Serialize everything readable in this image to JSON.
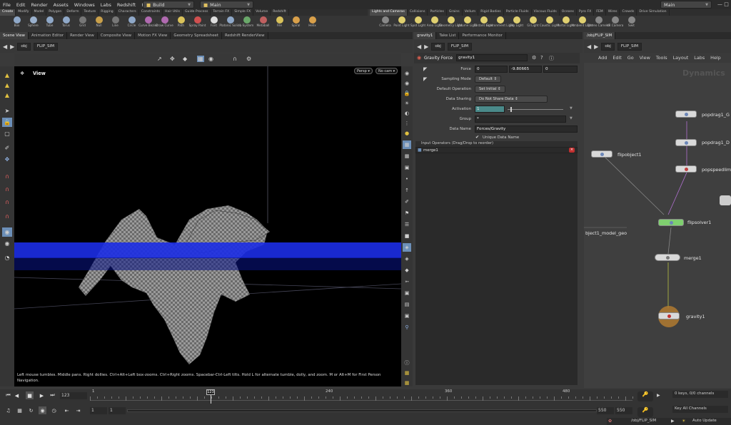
{
  "menu": [
    "File",
    "Edit",
    "Render",
    "Assets",
    "Windows",
    "Labs",
    "Redshift",
    "Help"
  ],
  "desktop": {
    "build": "Build",
    "main": "Main",
    "right_main": "Main"
  },
  "shelf_tabs_left": [
    "Create",
    "Modify",
    "Model",
    "Polygon",
    "Deform",
    "Texture",
    "Rigging",
    "Characters",
    "Constraints",
    "Hair Utils",
    "Guide Process",
    "Terrain FX",
    "Simple FX",
    "Volume",
    "Redshift"
  ],
  "shelf_tabs_right": [
    "Lights and Cameras",
    "Collisions",
    "Particles",
    "Grains",
    "Vellum",
    "Rigid Bodies",
    "Particle Fluids",
    "Viscous Fluids",
    "Oceans",
    "Pyro FX",
    "FEM",
    "Wires",
    "Crowds",
    "Drive Simulation"
  ],
  "tools_left": [
    {
      "label": "Box",
      "color": "#8fa8c8"
    },
    {
      "label": "Sphere",
      "color": "#9ab0cc"
    },
    {
      "label": "Tube",
      "color": "#8fa8c8"
    },
    {
      "label": "Torus",
      "color": "#8fa8c8"
    },
    {
      "label": "Grid",
      "color": "#777"
    },
    {
      "label": "Null",
      "color": "#c9a04a"
    },
    {
      "label": "Line",
      "color": "#777"
    },
    {
      "label": "Circle",
      "color": "#8fa8c8"
    },
    {
      "label": "Curve Bezier",
      "color": "#b06ab0"
    },
    {
      "label": "Draw Curve",
      "color": "#b06ab0"
    },
    {
      "label": "Path",
      "color": "#d9c25a"
    },
    {
      "label": "Spray Paint",
      "color": "#d05050"
    },
    {
      "label": "Font",
      "color": "#dddddd"
    },
    {
      "label": "Platonic Solids",
      "color": "#8fa8c8"
    },
    {
      "label": "L-System",
      "color": "#6aa86a"
    },
    {
      "label": "Metaball",
      "color": "#c06060"
    },
    {
      "label": "File",
      "color": "#d9c25a"
    },
    {
      "label": "Spiral",
      "color": "#d9a04a"
    },
    {
      "label": "Helix",
      "color": "#d9a04a"
    }
  ],
  "tools_right": [
    {
      "label": "Camera",
      "color": "#888"
    },
    {
      "label": "Point Light",
      "color": "#e0d070"
    },
    {
      "label": "Spot Light",
      "color": "#e0d070"
    },
    {
      "label": "Area Light",
      "color": "#e0d070"
    },
    {
      "label": "Geometry Light",
      "color": "#e0d070"
    },
    {
      "label": "Volume Light",
      "color": "#e0d070"
    },
    {
      "label": "Distant Light",
      "color": "#e0d070"
    },
    {
      "label": "Environment Light",
      "color": "#e0d070"
    },
    {
      "label": "Sky Light",
      "color": "#e0d070"
    },
    {
      "label": "GI Light",
      "color": "#e0d070"
    },
    {
      "label": "Caustic Light",
      "color": "#e0d070"
    },
    {
      "label": "Portal Light",
      "color": "#e0d070"
    },
    {
      "label": "Ambient Light",
      "color": "#e0d070"
    },
    {
      "label": "Stereo Camera",
      "color": "#888"
    },
    {
      "label": "VR Camera",
      "color": "#888"
    },
    {
      "label": "Swit",
      "color": "#888"
    }
  ],
  "pane_tabs_left": [
    "Scene View",
    "Animation Editor",
    "Render View",
    "Composite View",
    "Motion FX View",
    "Geometry Spreadsheet",
    "Redshift RenderView"
  ],
  "pane_tabs_mid": [
    "gravity1",
    "Take List",
    "Performance Monitor"
  ],
  "pane_tabs_right": [
    "/obj/FLIP_SIM"
  ],
  "path": {
    "context": "obj",
    "network": "FLIP_SIM"
  },
  "viewport": {
    "title": "View",
    "persp": "Persp ▾",
    "cam": "No cam ▾",
    "help": "Left mouse tumbles. Middle pans. Right dollies. Ctrl+Alt+Left box-zooms. Ctrl+Right zooms. Spacebar-Ctrl-Left tilts. Hold L for alternate tumble, dolly, and zoom. M or Alt+M for First Person Navigation."
  },
  "params": {
    "node_type": "Gravity Force",
    "node_name": "gravity1",
    "force_label": "Force",
    "force": [
      "0",
      "-9.80665",
      "0"
    ],
    "sampling_label": "Sampling Mode",
    "sampling": "Default",
    "default_op_label": "Default Operation",
    "default_op": "Set Initial",
    "data_sharing_label": "Data Sharing",
    "data_sharing": "Do Not Share Data",
    "activation_label": "Activation",
    "activation": "1",
    "group_label": "Group",
    "group": "*",
    "data_name_label": "Data Name",
    "data_name": "Forces/Gravity",
    "unique_label": "Unique Data Name",
    "input_ops_header": "Input Operators (Drag/Drop to reorder)",
    "input_op": "merge1"
  },
  "network": {
    "menu": [
      "Add",
      "Edit",
      "Go",
      "View",
      "Tools",
      "Layout",
      "Labs",
      "Help"
    ],
    "context_label": "Dynamics",
    "nodes": {
      "popdrag1": "popdrag1_G",
      "popdrag2": "popdrag1_D",
      "popspeed": "popspeedlim",
      "flipobject": "flipobject1",
      "flipsolver": "flipsolver1",
      "merge": "merge1",
      "gravity": "gravity1",
      "objmerge": "bject1_model_geo"
    }
  },
  "timeline": {
    "frame": "123",
    "ticks": [
      "1",
      "240",
      "360",
      "480"
    ],
    "marker": "123",
    "start": "1",
    "start2": "1",
    "end": "550",
    "end2": "550",
    "keys": "0 keys, 0/0 channels",
    "key_all": "Key All Channels",
    "status_path": "/obj/FLIP_SIM",
    "auto_update": "Auto Update"
  }
}
